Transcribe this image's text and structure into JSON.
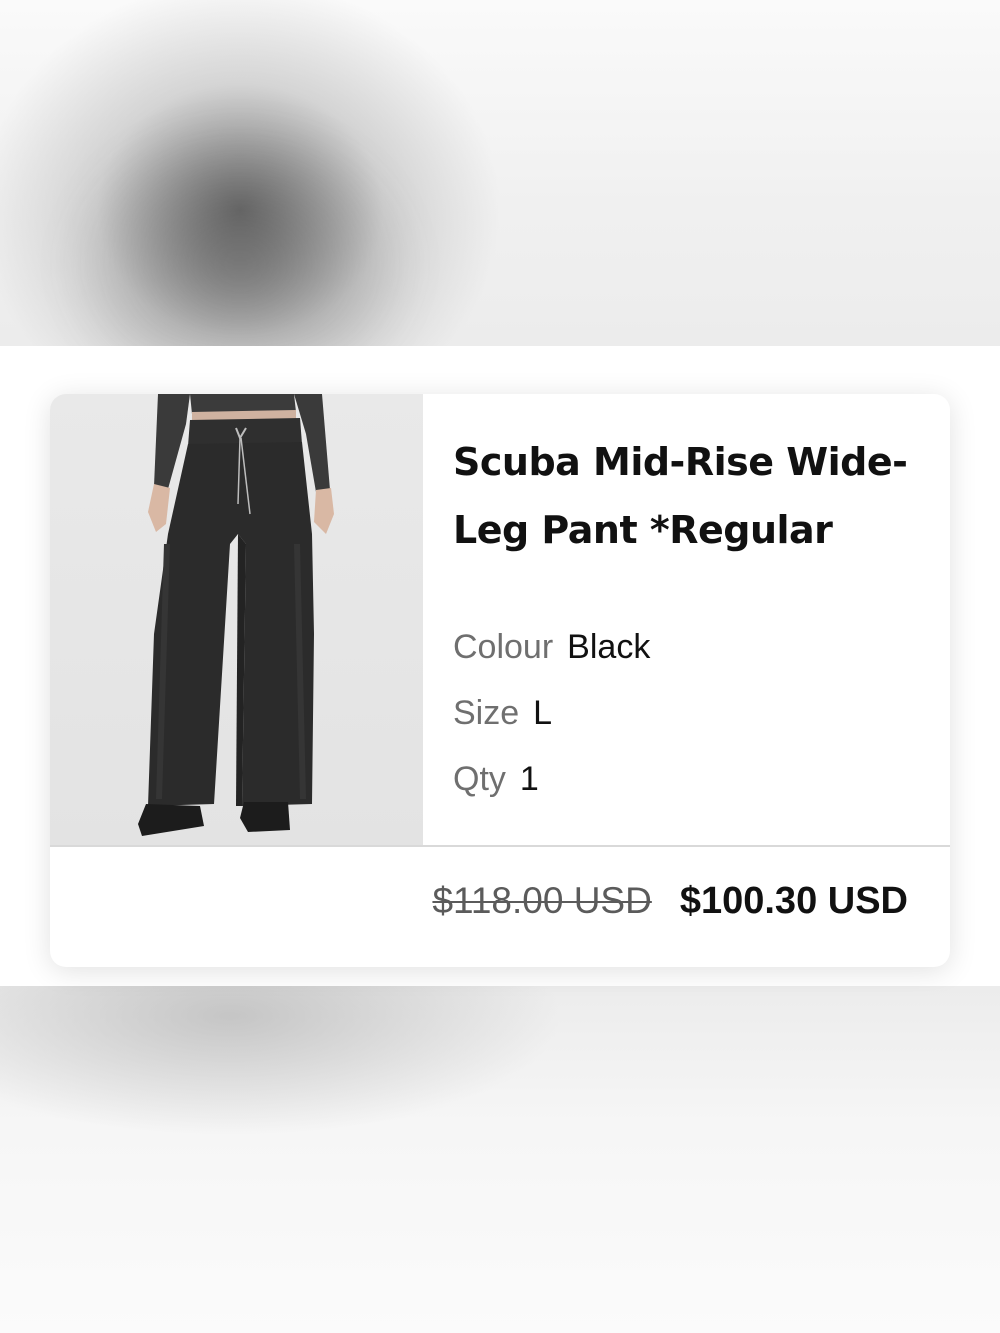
{
  "product": {
    "title": "Scuba Mid-Rise Wide-Leg Pant *Regular",
    "image_alt": "Model wearing black wide-leg pants",
    "attributes": [
      {
        "label": "Colour",
        "value": "Black"
      },
      {
        "label": "Size",
        "value": "L"
      },
      {
        "label": "Qty",
        "value": "1"
      }
    ],
    "price": {
      "original": "$118.00 USD",
      "current": "$100.30 USD"
    }
  },
  "colors": {
    "text_primary": "#111111",
    "text_secondary": "#6f6f6f",
    "image_background": "#e5e5e5",
    "pants": "#2b2b2b"
  }
}
